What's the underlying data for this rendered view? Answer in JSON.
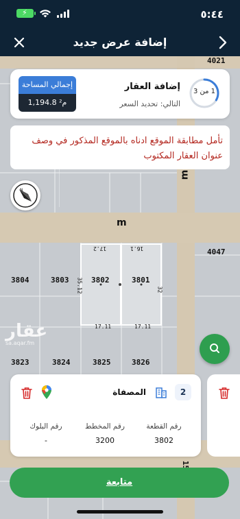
{
  "status": {
    "time": "٥:٤٤"
  },
  "nav": {
    "title": "إضافة عرض جديد",
    "back_icon": "chevron-right-icon",
    "close_icon": "close-icon"
  },
  "step": {
    "progress_text": "1 من 3",
    "progress": 0.333,
    "title": "إضافة العقار",
    "next": "التالي: تحديد السعر",
    "area_label": "إجمالي المساحة",
    "area_value": "1,194.8 م²"
  },
  "warning": "تأمل مطابقة الموقع ادناه بالموقع المذكور في وصف عنوان العقار المكتوب",
  "map": {
    "street_letter": "m",
    "labels": {
      "l4021": "4021",
      "l4047": "4047",
      "l3804": "3804",
      "l3803": "3803",
      "l3802": "3802",
      "l3801": "3801",
      "l3823": "3823",
      "l3824": "3824",
      "l3825": "3825",
      "l3826": "3826",
      "d1": "17.2",
      "d2": "16.1",
      "d3": "35.12",
      "d4": "32",
      "d5": "17.11",
      "d6": "17.11",
      "d7": "15"
    },
    "watermark": {
      "name": "عقار",
      "url": "sa.aqar.fm"
    }
  },
  "property": {
    "index": "2",
    "district": "المصفاة",
    "plot_label": "رقم القطعة",
    "plot_value": "3802",
    "plan_label": "رقم المخطط",
    "plan_value": "3200",
    "block_label": "رقم البلوك",
    "block_value": "-"
  },
  "continue_label": "متابعة",
  "colors": {
    "accent_green": "#32a152",
    "header_navy": "#0e2336",
    "warning_red": "#b3261e",
    "area_blue": "#3b7dd8"
  }
}
